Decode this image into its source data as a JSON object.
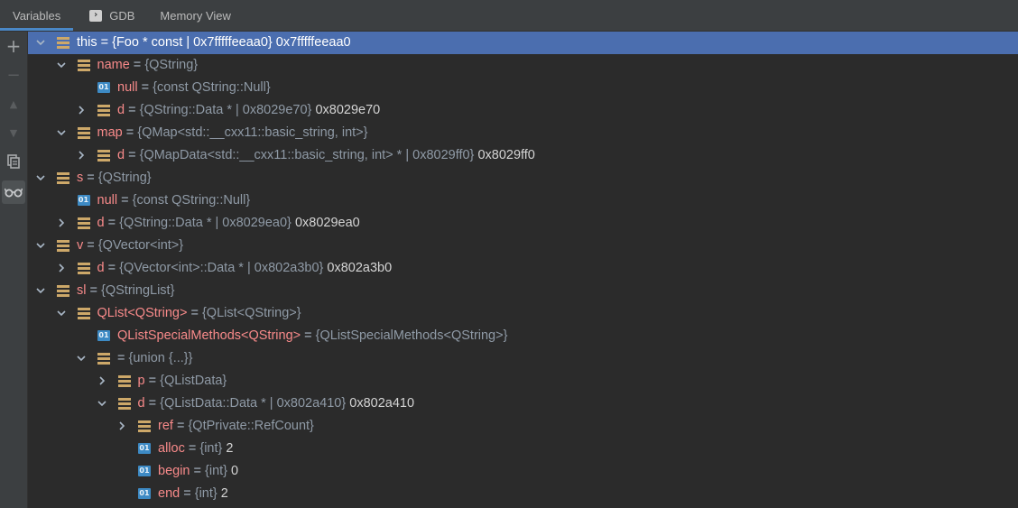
{
  "tabs": [
    {
      "label": "Variables"
    },
    {
      "label": "GDB"
    },
    {
      "label": "Memory View"
    }
  ],
  "toolbar": {
    "add": "+",
    "remove": "−",
    "up": "▲",
    "down": "▼",
    "copy": "⧉",
    "watch": "oo"
  },
  "tree": [
    {
      "name": "this",
      "type": "{Foo * const | 0x7fffffeeaa0}",
      "value": "0x7fffffeeaa0"
    },
    {
      "name": "name",
      "type": "{QString}",
      "value": ""
    },
    {
      "name": "null",
      "type": "{const QString::Null}",
      "value": ""
    },
    {
      "name": "d",
      "type": "{QString::Data * | 0x8029e70}",
      "value": "0x8029e70"
    },
    {
      "name": "map",
      "type": "{QMap<std::__cxx11::basic_string, int>}",
      "value": ""
    },
    {
      "name": "d",
      "type": "{QMapData<std::__cxx11::basic_string, int> * | 0x8029ff0}",
      "value": "0x8029ff0"
    },
    {
      "name": "s",
      "type": "{QString}",
      "value": ""
    },
    {
      "name": "null",
      "type": "{const QString::Null}",
      "value": ""
    },
    {
      "name": "d",
      "type": "{QString::Data * | 0x8029ea0}",
      "value": "0x8029ea0"
    },
    {
      "name": "v",
      "type": "{QVector<int>}",
      "value": ""
    },
    {
      "name": "d",
      "type": "{QVector<int>::Data * | 0x802a3b0}",
      "value": "0x802a3b0"
    },
    {
      "name": "sl",
      "type": "{QStringList}",
      "value": ""
    },
    {
      "name": "QList<QString>",
      "type": "{QList<QString>}",
      "value": ""
    },
    {
      "name": "QListSpecialMethods<QString>",
      "type": "{QListSpecialMethods<QString>}",
      "value": ""
    },
    {
      "name": "",
      "type": "{union {...}}",
      "value": ""
    },
    {
      "name": "p",
      "type": "{QListData}",
      "value": ""
    },
    {
      "name": "d",
      "type": "{QListData::Data * | 0x802a410}",
      "value": "0x802a410"
    },
    {
      "name": "ref",
      "type": "{QtPrivate::RefCount}",
      "value": ""
    },
    {
      "name": "alloc",
      "type": "{int}",
      "value": "2"
    },
    {
      "name": "begin",
      "type": "{int}",
      "value": "0"
    },
    {
      "name": "end",
      "type": "{int}",
      "value": "2"
    }
  ],
  "colors": {
    "background": "#2b2b2b",
    "selection": "#4b6eaf",
    "var_name": "#f88a8a",
    "struct_icon": "#cda869",
    "prim_icon": "#3d8ac4"
  }
}
